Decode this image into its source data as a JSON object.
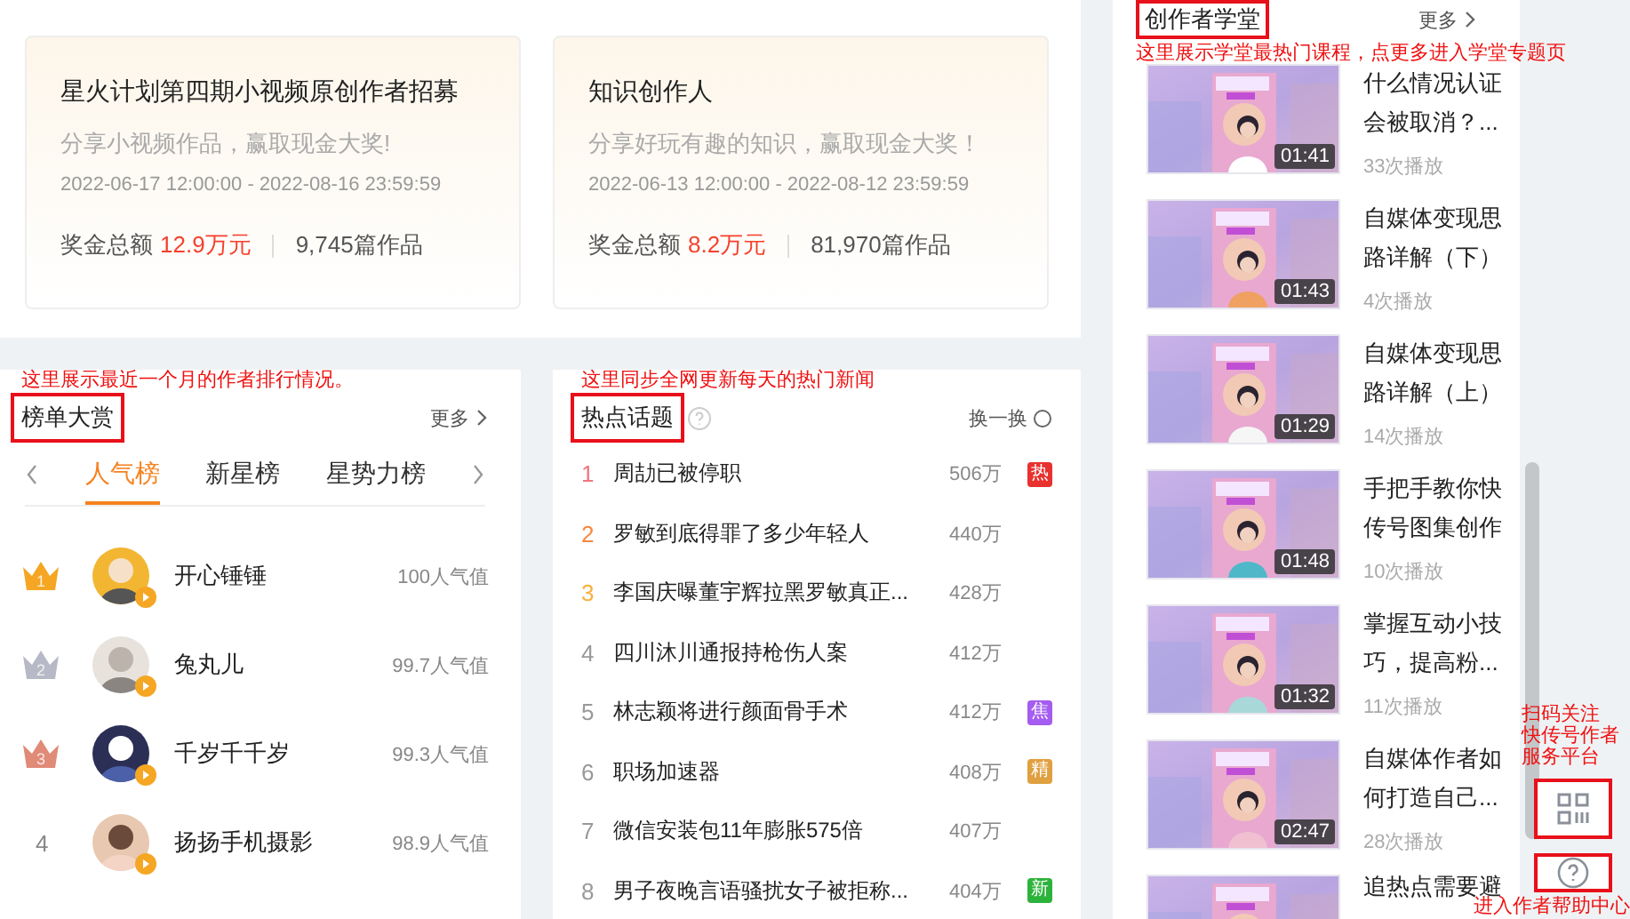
{
  "campaigns": [
    {
      "title": "星火计划第四期小视频原创作者招募",
      "subtitle": "分享小视频作品，赢取现金大奖!",
      "period": "2022-06-17 12:00:00 - 2022-08-16 23:59:59",
      "prize_label": "奖金总额",
      "prize": "12.9万元",
      "works": "9,745篇作品"
    },
    {
      "title": "知识创作人",
      "subtitle": "分享好玩有趣的知识，赢取现金大奖！",
      "period": "2022-06-13 12:00:00 - 2022-08-12 23:59:59",
      "prize_label": "奖金总额",
      "prize": "8.2万元",
      "works": "81,970篇作品"
    }
  ],
  "ranking": {
    "note": "这里展示最近一个月的作者排行情况。",
    "title": "榜单大赏",
    "highlighted": true,
    "more": "更多",
    "tabs": [
      {
        "label": "人气榜",
        "selected": true
      },
      {
        "label": "新星榜",
        "selected": false
      },
      {
        "label": "星势力榜",
        "selected": false
      }
    ],
    "rows": [
      {
        "kind": "crown",
        "rank": "1",
        "color": "#f5a623",
        "name": "开心锤锤",
        "value": "100人气值"
      },
      {
        "kind": "crown",
        "rank": "2",
        "color": "#b8b9c6",
        "name": "兔丸儿",
        "value": "99.7人气值"
      },
      {
        "kind": "crown",
        "rank": "3",
        "color": "#e08a78",
        "name": "千岁千千岁",
        "value": "99.3人气值"
      },
      {
        "kind": "plain",
        "rank": "4",
        "name": "扬扬手机摄影",
        "value": "98.9人气值"
      }
    ]
  },
  "hot_topics": {
    "note": "这里同步全网更新每天的热门新闻",
    "title": "热点话题",
    "highlighted": true,
    "refresh": "换一换",
    "rows": [
      {
        "rank": "1",
        "color": "#f0757f",
        "title": "周劼已被停职",
        "count": "506万",
        "tag": {
          "text": "热",
          "color": "#e8322f"
        }
      },
      {
        "rank": "2",
        "color": "#f7883c",
        "title": "罗敏到底得罪了多少年轻人",
        "count": "440万"
      },
      {
        "rank": "3",
        "color": "#f7b03c",
        "title": "李国庆曝董宇辉拉黑罗敏真正...",
        "count": "428万"
      },
      {
        "rank": "4",
        "color": "#999999",
        "title": "四川沐川通报持枪伤人案",
        "count": "412万"
      },
      {
        "rank": "5",
        "color": "#999999",
        "title": "林志颖将进行颜面骨手术",
        "count": "412万",
        "tag": {
          "text": "焦",
          "color": "#a55cf0"
        }
      },
      {
        "rank": "6",
        "color": "#999999",
        "title": "职场加速器",
        "count": "408万",
        "tag": {
          "text": "精",
          "color": "#e0a040"
        }
      },
      {
        "rank": "7",
        "color": "#999999",
        "title": "微信安装包11年膨胀575倍",
        "count": "407万"
      },
      {
        "rank": "8",
        "color": "#999999",
        "title": "男子夜晚言语骚扰女子被拒称...",
        "count": "404万",
        "tag": {
          "text": "新",
          "color": "#2db33c"
        }
      }
    ]
  },
  "academy": {
    "title": "创作者学堂",
    "highlighted": true,
    "more": "更多",
    "note": "这里展示学堂最热门课程，点更多进入学堂专题页",
    "courses": [
      {
        "title": "什么情况认证会被取消？...",
        "duration": "01:41",
        "views": "33次播放"
      },
      {
        "title": "自媒体变现思路详解（下）",
        "duration": "01:43",
        "views": "4次播放"
      },
      {
        "title": "自媒体变现思路详解（上）",
        "duration": "01:29",
        "views": "14次播放"
      },
      {
        "title": "手把手教你快传号图集创作",
        "duration": "01:48",
        "views": "10次播放"
      },
      {
        "title": "掌握互动小技巧，提高粉...",
        "duration": "01:32",
        "views": "11次播放"
      },
      {
        "title": "自媒体作者如何打造自己...",
        "duration": "02:47",
        "views": "28次播放"
      },
      {
        "title": "追热点需要避"
      }
    ]
  },
  "float_tools": {
    "qr_note": [
      "扫码关注",
      "快传号作者",
      "服务平台"
    ],
    "qr_highlighted": true,
    "help_note": "进入作者帮助中心",
    "help_highlighted": true
  }
}
